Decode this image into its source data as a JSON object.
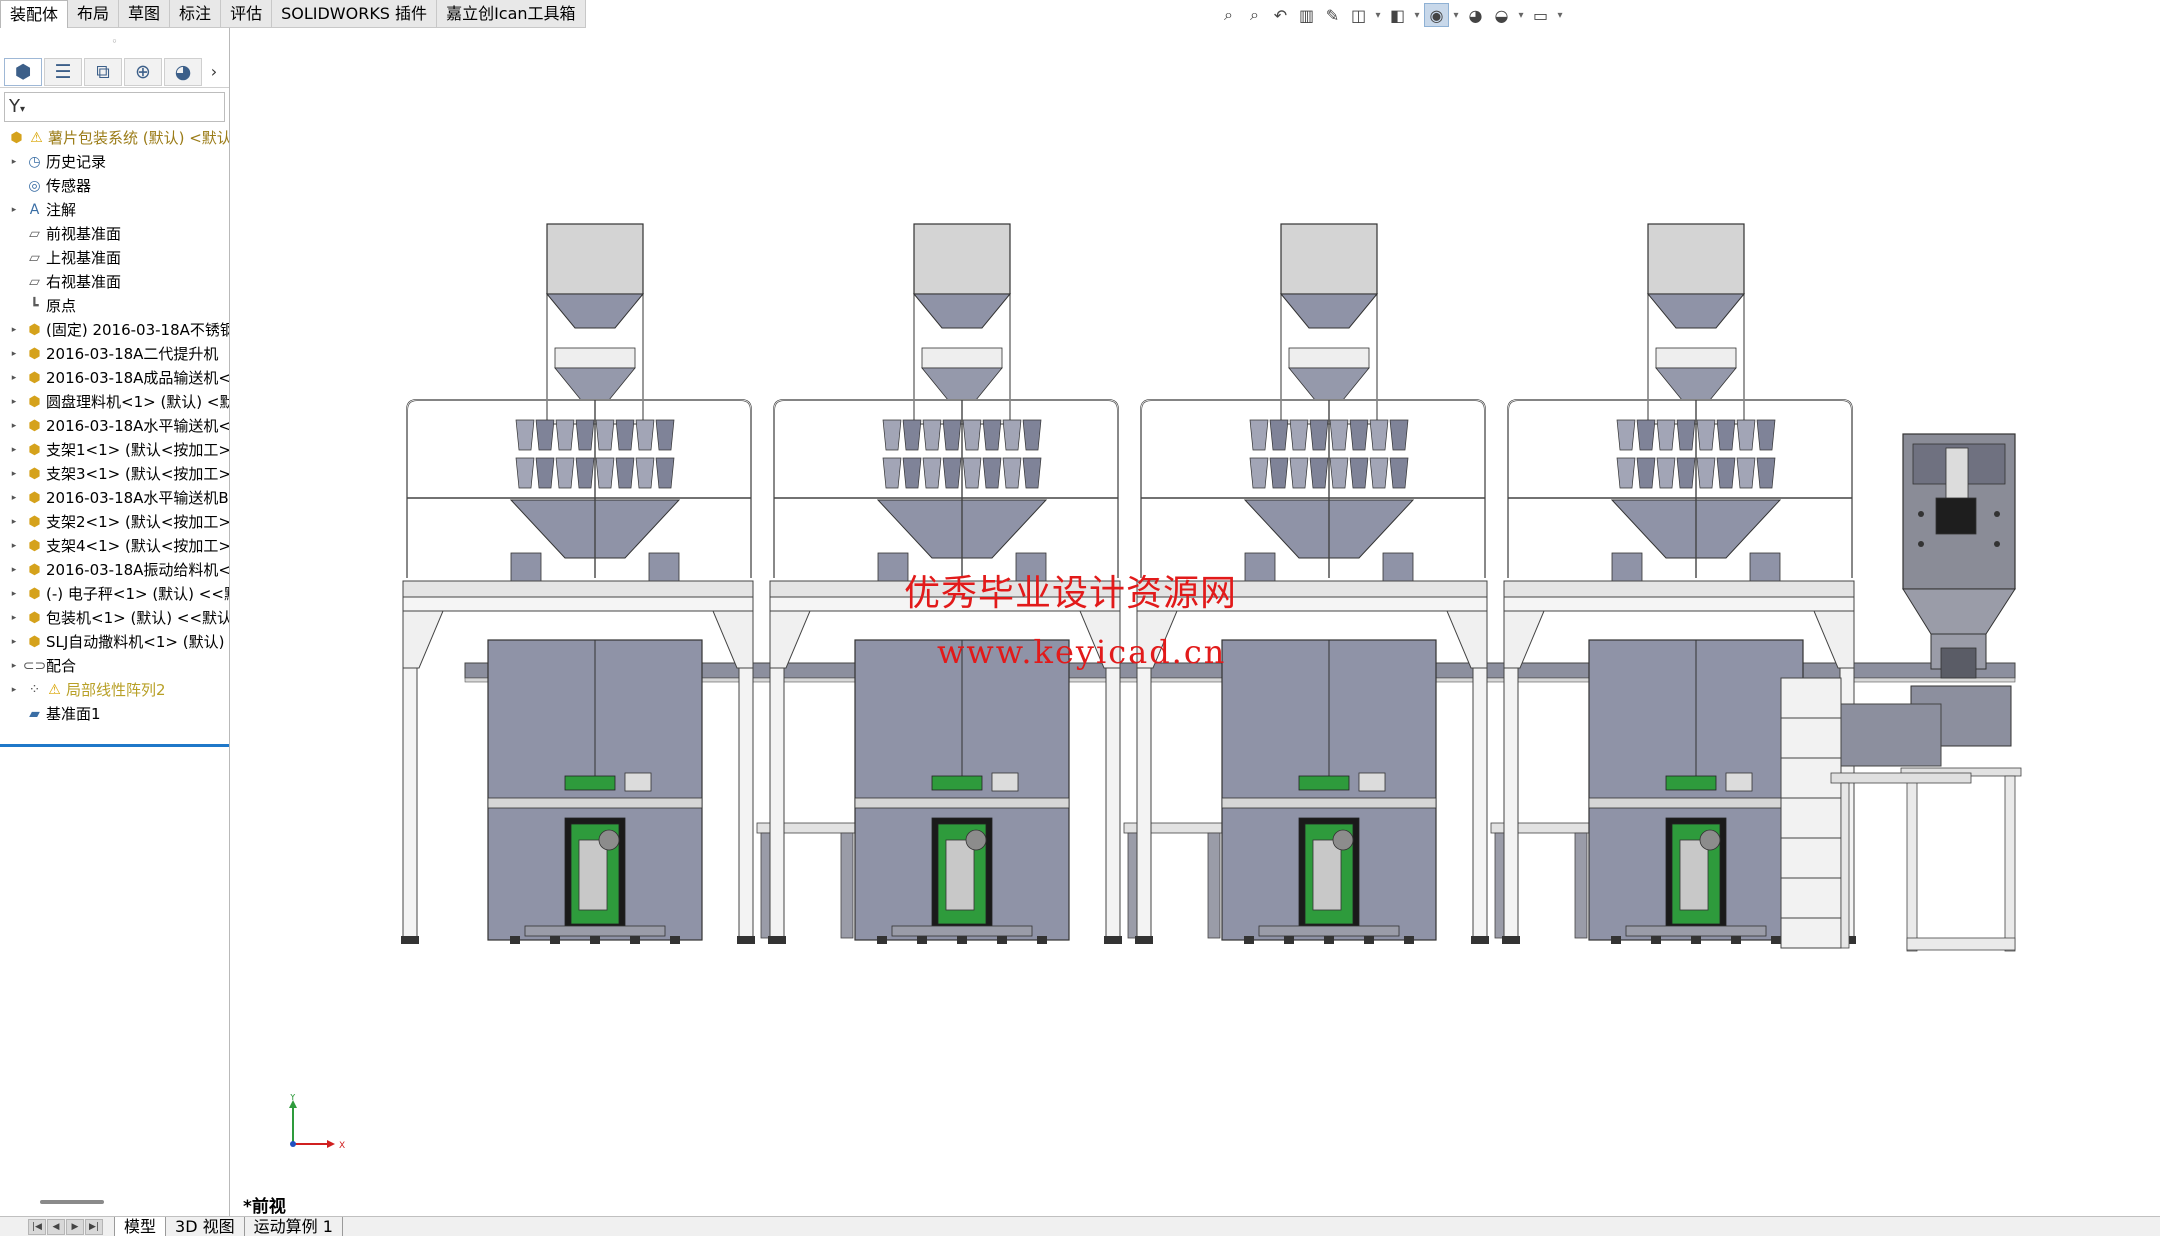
{
  "ribbon": {
    "tabs": [
      {
        "label": "装配体",
        "active": true
      },
      {
        "label": "布局"
      },
      {
        "label": "草图"
      },
      {
        "label": "标注"
      },
      {
        "label": "评估"
      },
      {
        "label": "SOLIDWORKS 插件"
      },
      {
        "label": "嘉立创Ican工具箱"
      }
    ],
    "view_tools": [
      "zoom-to-fit-icon",
      "zoom-to-area-icon",
      "previous-view-icon",
      "section-view-icon",
      "dynamic-annotation-icon",
      "view-orientation-icon",
      "display-style-icon",
      "hide-show-items-icon",
      "edit-appearance-icon",
      "apply-scene-icon",
      "view-settings-icon"
    ]
  },
  "feature_manager": {
    "splitter_glyph": "◦",
    "tab_icons": [
      "feature-manager-icon",
      "property-manager-icon",
      "configuration-manager-icon",
      "dimxpert-icon",
      "display-manager-icon"
    ],
    "more_glyph": "›",
    "filter_glyph": "Y",
    "tree": [
      {
        "label": "薯片包装系统 (默认) <默认",
        "icon": "assembly-icon",
        "expand": "▸",
        "warning": true
      },
      {
        "label": "历史记录",
        "icon": "history-icon",
        "expand": "▸"
      },
      {
        "label": "传感器",
        "icon": "sensor-icon",
        "expand": ""
      },
      {
        "label": "注解",
        "icon": "annotation-icon",
        "expand": "▸"
      },
      {
        "label": "前视基准面",
        "icon": "plane-icon",
        "expand": ""
      },
      {
        "label": "上视基准面",
        "icon": "plane-icon",
        "expand": ""
      },
      {
        "label": "右视基准面",
        "icon": "plane-icon",
        "expand": ""
      },
      {
        "label": "原点",
        "icon": "origin-icon",
        "expand": ""
      },
      {
        "label": "(固定) 2016-03-18A不锈钢",
        "icon": "part-icon",
        "expand": "▸"
      },
      {
        "label": "2016-03-18A二代提升机",
        "icon": "part-icon",
        "expand": "▸"
      },
      {
        "label": "2016-03-18A成品输送机<",
        "icon": "part-icon",
        "expand": "▸"
      },
      {
        "label": "圆盘理料机<1> (默认) <默",
        "icon": "part-icon",
        "expand": "▸"
      },
      {
        "label": "2016-03-18A水平输送机<",
        "icon": "part-icon",
        "expand": "▸"
      },
      {
        "label": "支架1<1> (默认<按加工>",
        "icon": "part-icon",
        "expand": "▸"
      },
      {
        "label": "支架3<1> (默认<按加工>",
        "icon": "part-icon",
        "expand": "▸"
      },
      {
        "label": "2016-03-18A水平输送机B",
        "icon": "part-icon",
        "expand": "▸"
      },
      {
        "label": "支架2<1> (默认<按加工>",
        "icon": "part-icon",
        "expand": "▸"
      },
      {
        "label": "支架4<1> (默认<按加工>",
        "icon": "part-icon",
        "expand": "▸"
      },
      {
        "label": "2016-03-18A振动给料机<",
        "icon": "part-icon",
        "expand": "▸"
      },
      {
        "label": "(-) 电子秤<1> (默认) <<默",
        "icon": "part-icon",
        "expand": "▸"
      },
      {
        "label": "包装机<1> (默认) <<默认",
        "icon": "part-icon",
        "expand": "▸"
      },
      {
        "label": "SLJ自动撒料机<1> (默认)",
        "icon": "part-icon",
        "expand": "▸"
      },
      {
        "label": "配合",
        "icon": "mates-icon",
        "expand": "▸"
      },
      {
        "label": "局部线性阵列2",
        "icon": "pattern-icon",
        "expand": "▸",
        "warning": true
      },
      {
        "label": "基准面1",
        "icon": "plane-solid-icon",
        "expand": ""
      }
    ]
  },
  "graphics": {
    "watermark_line1": "优秀毕业设计资源网",
    "watermark_line2": "www.keyicad.cn",
    "view_name": "*前视",
    "triad": {
      "y_label": "Y",
      "x_label": "X"
    },
    "colors": {
      "body": "#8f93a7",
      "hopper": "#d4d4d4",
      "frame": "#e4e4e4",
      "accent_green": "#2e9b3c",
      "watermark": "#e21a1a"
    }
  },
  "bottom_tabs": [
    "模型",
    "3D 视图",
    "运动算例 1"
  ],
  "nav_buttons": [
    "|◀",
    "◀",
    "▶",
    "▶|"
  ]
}
